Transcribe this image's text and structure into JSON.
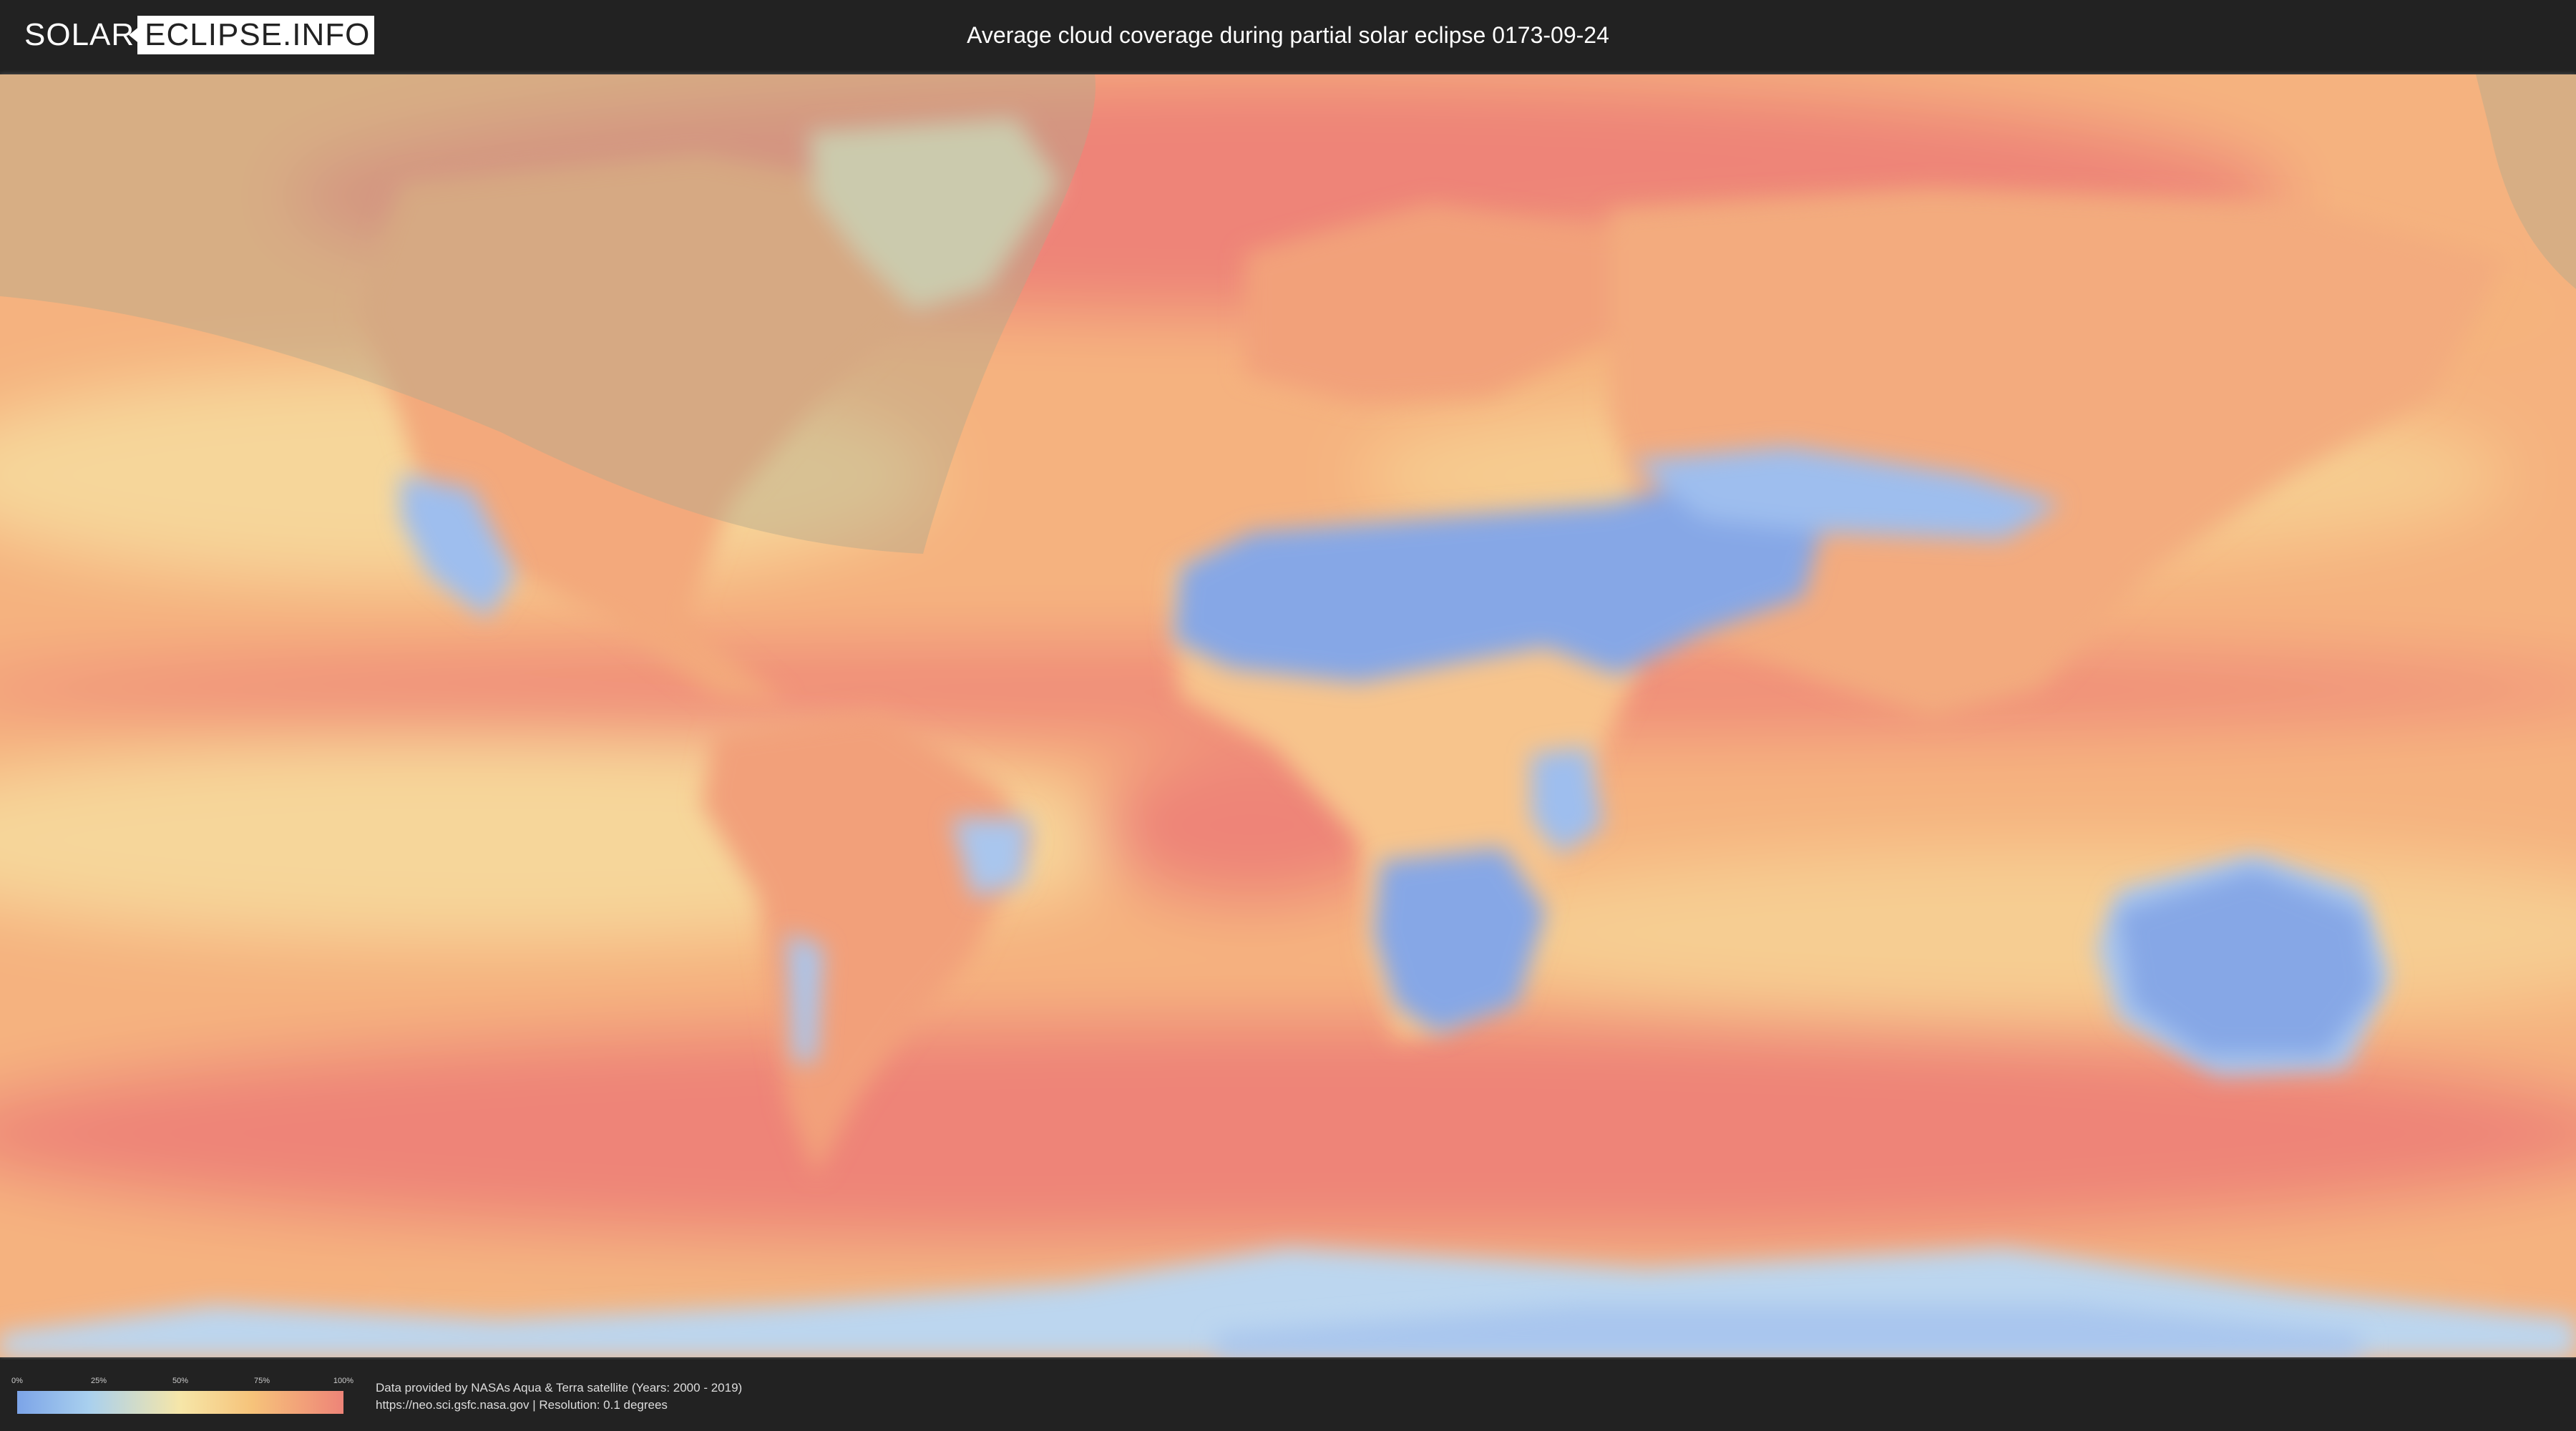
{
  "header": {
    "logo_part1": "SOLAR",
    "logo_part2": "ECLIPSE.INFO",
    "title": "Average cloud coverage during partial solar eclipse 0173-09-24"
  },
  "map": {
    "type": "world-cloud-coverage-map",
    "projection": "equirectangular",
    "eclipse_visibility_overlay": "northern-hemisphere-western-region",
    "colors": {
      "clear": "#7ca4e8",
      "low": "#a9d0ee",
      "mid": "#f6e6a8",
      "high": "#f6c37a",
      "overcast": "#ee8478",
      "overlay": "#b4a98c"
    }
  },
  "legend": {
    "ticks": [
      "0%",
      "25%",
      "50%",
      "75%",
      "100%"
    ],
    "gradient_colors": [
      "#7ca4e8",
      "#a9d0ee",
      "#f6e6a8",
      "#f6c37a",
      "#ee8478"
    ]
  },
  "footer": {
    "credit_line1": "Data provided by NASAs Aqua & Terra satellite (Years: 2000 - 2019)",
    "credit_line2": "https://neo.sci.gsfc.nasa.gov | Resolution: 0.1 degrees"
  }
}
